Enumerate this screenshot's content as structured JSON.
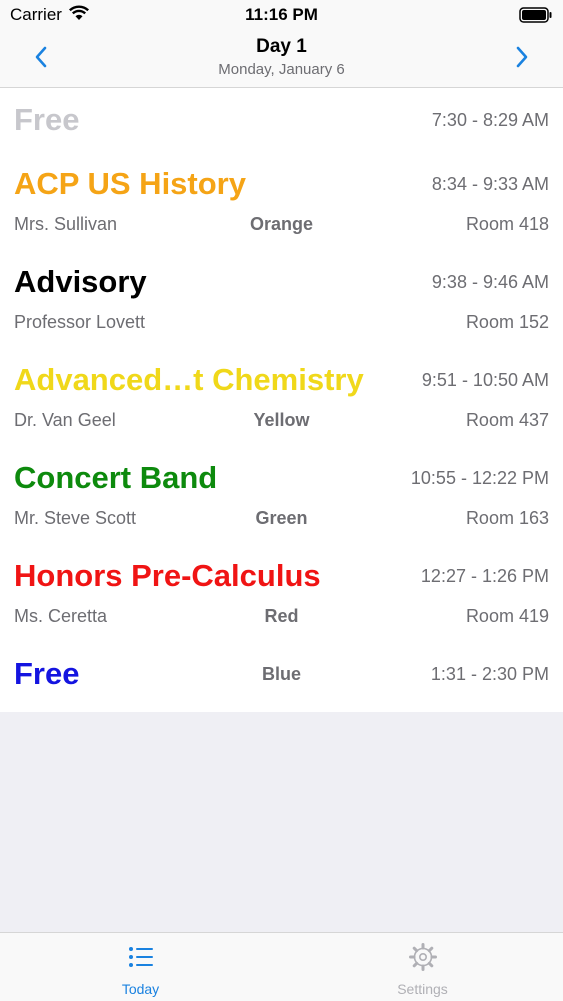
{
  "status_bar": {
    "carrier": "Carrier",
    "time": "11:16 PM",
    "icons": [
      "wifi-icon",
      "battery-icon"
    ]
  },
  "nav": {
    "title": "Day 1",
    "subtitle": "Monday, January 6",
    "prev_icon": "chevron-left-icon",
    "next_icon": "chevron-right-icon",
    "tint_color": "#1a82e0"
  },
  "periods": [
    {
      "name": "Free",
      "color": "#c7c7cc",
      "time": "7:30 - 8:29 AM",
      "teacher": "",
      "block": "",
      "room": ""
    },
    {
      "name": "ACP US History",
      "color": "#f5a416",
      "time": "8:34 - 9:33 AM",
      "teacher": "Mrs. Sullivan",
      "block": "Orange",
      "room": "Room 418"
    },
    {
      "name": "Advisory",
      "color": "#000000",
      "time": "9:38 - 9:46 AM",
      "teacher": "Professor Lovett",
      "block": "",
      "room": "Room 152"
    },
    {
      "name": "Advanced…t Chemistry",
      "color": "#f0d81a",
      "time": "9:51 - 10:50 AM",
      "teacher": "Dr. Van Geel",
      "block": "Yellow",
      "room": "Room 437"
    },
    {
      "name": "Concert Band",
      "color": "#0d8a0d",
      "time": "10:55 - 12:22 PM",
      "teacher": "Mr. Steve Scott",
      "block": "Green",
      "room": "Room 163"
    },
    {
      "name": "Honors Pre-Calculus",
      "color": "#f01414",
      "time": "12:27 - 1:26 PM",
      "teacher": "Ms. Ceretta",
      "block": "Red",
      "room": "Room 419"
    },
    {
      "name": "Free",
      "color": "#1414e0",
      "time": "1:31 - 2:30 PM",
      "teacher": "",
      "block": "Blue",
      "room": ""
    }
  ],
  "tabs": [
    {
      "label": "Today",
      "icon": "list-icon",
      "selected": true,
      "color": "#1a82e0"
    },
    {
      "label": "Settings",
      "icon": "gear-icon",
      "selected": false,
      "color": "#b0b0b5"
    }
  ]
}
